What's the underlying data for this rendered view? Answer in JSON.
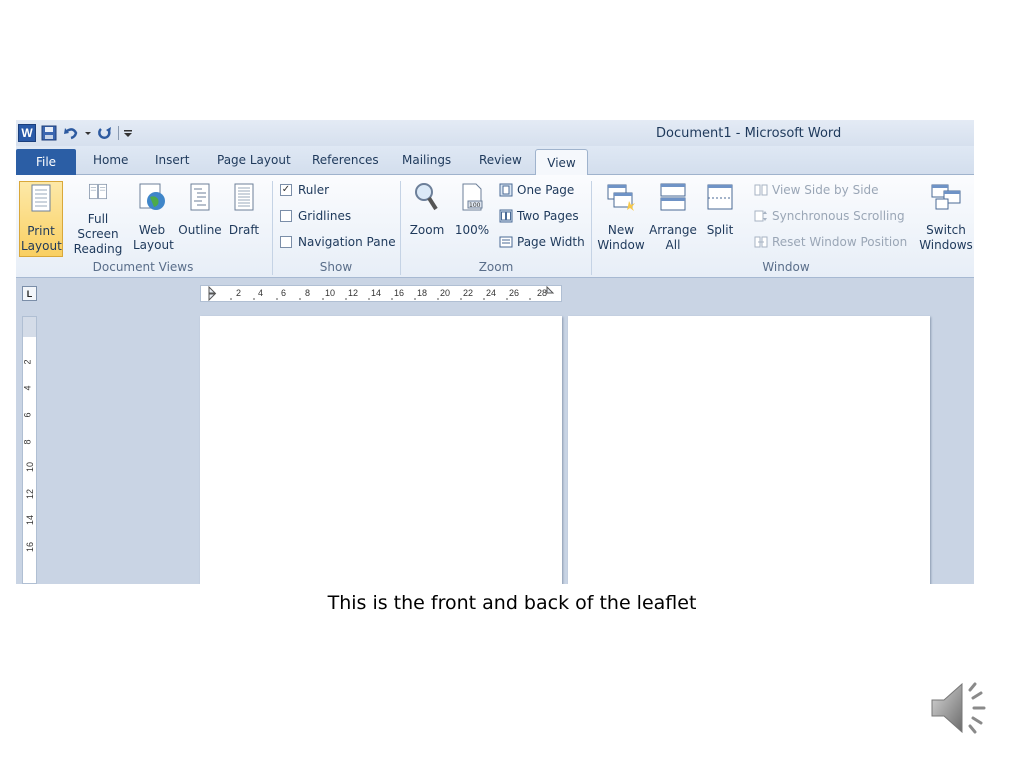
{
  "title_bar": {
    "app_logo_letter": "W",
    "document_title": "Document1 - Microsoft Word"
  },
  "tabs": {
    "file": "File",
    "items": [
      "Home",
      "Insert",
      "Page Layout",
      "References",
      "Mailings",
      "Review"
    ],
    "active": "View"
  },
  "ribbon": {
    "document_views": {
      "label": "Document Views",
      "print_layout": "Print Layout",
      "full_screen_reading": "Full Screen Reading",
      "web_layout": "Web Layout",
      "outline": "Outline",
      "draft": "Draft"
    },
    "show": {
      "label": "Show",
      "ruler": "Ruler",
      "gridlines": "Gridlines",
      "navigation_pane": "Navigation Pane",
      "ruler_checked": true
    },
    "zoom": {
      "label": "Zoom",
      "zoom": "Zoom",
      "hundred": "100%",
      "one_page": "One Page",
      "two_pages": "Two Pages",
      "page_width": "Page Width"
    },
    "window": {
      "label": "Window",
      "new_window": "New Window",
      "arrange_all": "Arrange All",
      "split": "Split",
      "view_side_by_side": "View Side by Side",
      "synchronous_scrolling": "Synchronous Scrolling",
      "reset_window_position": "Reset Window Position",
      "switch_windows": "Switch Windows"
    }
  },
  "ruler": {
    "corner": "L",
    "horizontal": [
      "2",
      "4",
      "6",
      "8",
      "10",
      "12",
      "14",
      "16",
      "18",
      "20",
      "22",
      "24",
      "26",
      "28"
    ],
    "vertical": [
      "2",
      "4",
      "6",
      "8",
      "10",
      "12",
      "14",
      "16"
    ]
  },
  "caption": "This is the front and back of the leaflet",
  "colors": {
    "file_tab": "#2b5ea5",
    "active_button": "#f9cf62",
    "workspace": "#c9d4e4"
  }
}
